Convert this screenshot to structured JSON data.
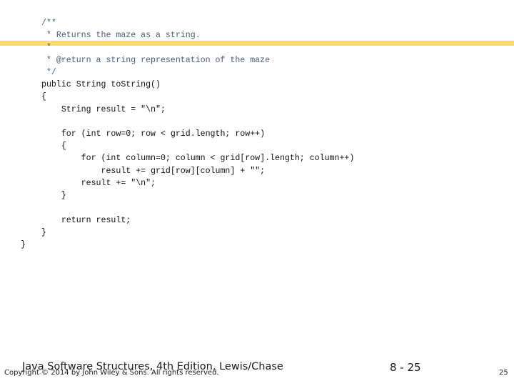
{
  "slide": {
    "code_lines": [
      {
        "text": "/**",
        "kind": "comment"
      },
      {
        "text": " * Returns the maze as a string.",
        "kind": "comment"
      },
      {
        "text": " *",
        "kind": "comment"
      },
      {
        "text": " * @return a string representation of the maze",
        "kind": "comment"
      },
      {
        "text": " */",
        "kind": "comment"
      },
      {
        "text": "public String toString()",
        "kind": "code"
      },
      {
        "text": "{",
        "kind": "code"
      },
      {
        "text": "    String result = \"\\n\";",
        "kind": "code"
      },
      {
        "text": "",
        "kind": "code"
      },
      {
        "text": "    for (int row=0; row < grid.length; row++)",
        "kind": "code"
      },
      {
        "text": "    {",
        "kind": "code"
      },
      {
        "text": "        for (int column=0; column < grid[row].length; column++)",
        "kind": "code"
      },
      {
        "text": "            result += grid[row][column] + \"\";",
        "kind": "code"
      },
      {
        "text": "        result += \"\\n\";",
        "kind": "code"
      },
      {
        "text": "    }",
        "kind": "code"
      },
      {
        "text": "",
        "kind": "code"
      },
      {
        "text": "    return result;",
        "kind": "code"
      },
      {
        "text": "}",
        "kind": "code"
      },
      {
        "text": "}",
        "kind": "code"
      }
    ],
    "highlight_color": "#fddb6d"
  },
  "footer": {
    "title": "Java Software Structures, 4th Edition, Lewis/Chase",
    "copyright": "Copyright © 2014 by John Wiley & Sons. All rights reserved.",
    "slide_number": "8 - 25",
    "page_number": "25"
  }
}
